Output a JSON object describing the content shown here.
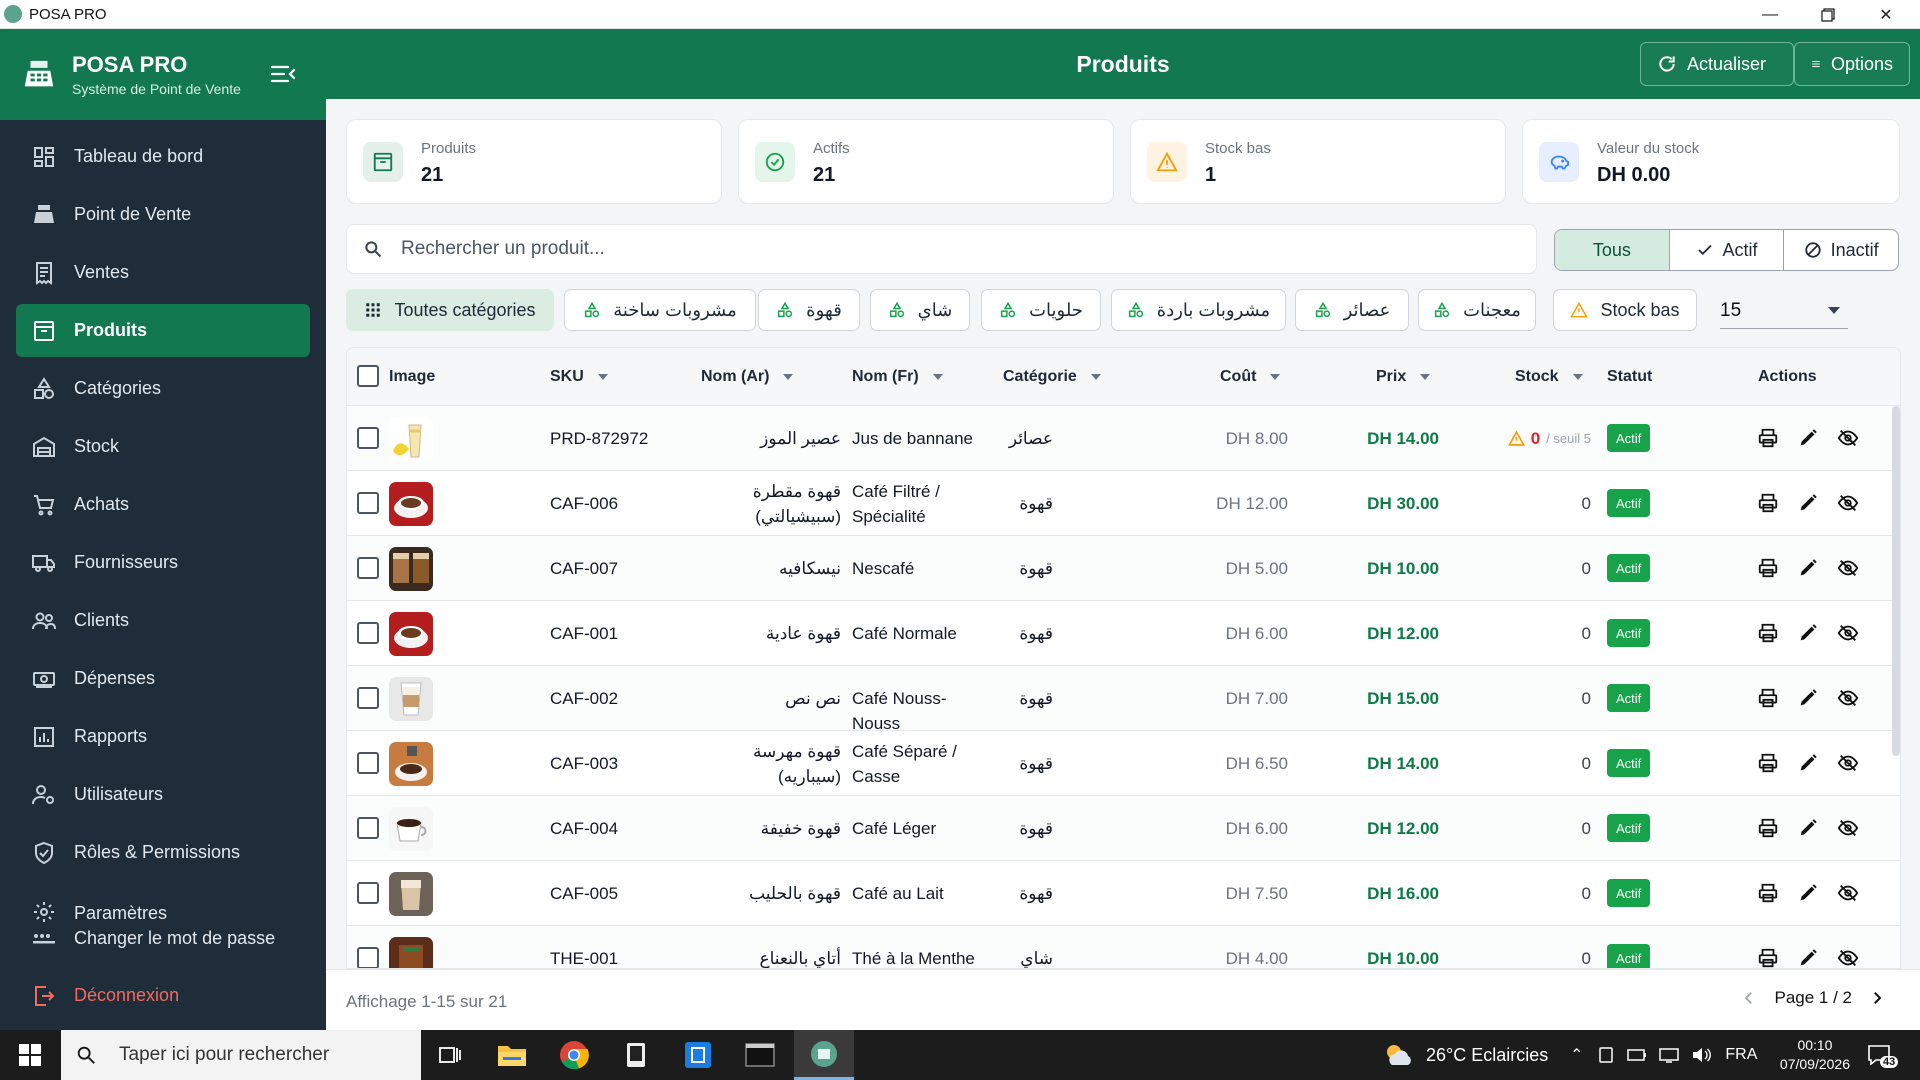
{
  "window": {
    "title": "POSA PRO"
  },
  "brand": {
    "name": "POSA PRO",
    "subtitle": "Système de Point de Vente"
  },
  "nav": [
    {
      "label": "Tableau de bord",
      "icon": "dashboard-icon"
    },
    {
      "label": "Point de Vente",
      "icon": "cash-register-icon"
    },
    {
      "label": "Ventes",
      "icon": "receipt-icon"
    },
    {
      "label": "Produits",
      "icon": "product-box-icon",
      "active": true
    },
    {
      "label": "Catégories",
      "icon": "categories-icon"
    },
    {
      "label": "Stock",
      "icon": "warehouse-icon"
    },
    {
      "label": "Achats",
      "icon": "cart-icon"
    },
    {
      "label": "Fournisseurs",
      "icon": "truck-icon"
    },
    {
      "label": "Clients",
      "icon": "users-icon"
    },
    {
      "label": "Dépenses",
      "icon": "money-icon"
    },
    {
      "label": "Rapports",
      "icon": "chart-icon"
    },
    {
      "label": "Utilisateurs",
      "icon": "user-cog-icon"
    },
    {
      "label": "Rôles & Permissions",
      "icon": "shield-icon"
    },
    {
      "label": "Paramètres",
      "icon": "gear-icon"
    }
  ],
  "nav_bottom": {
    "change_password": "Changer le mot de passe",
    "logout": "Déconnexion"
  },
  "header": {
    "title": "Produits",
    "refresh_label": "Actualiser",
    "options_label": "Options"
  },
  "stats": [
    {
      "label": "Produits",
      "value": "21",
      "icon": "box-icon",
      "color": "#11784f"
    },
    {
      "label": "Actifs",
      "value": "21",
      "icon": "check-circle-icon",
      "color": "#16a34a"
    },
    {
      "label": "Stock bas",
      "value": "1",
      "icon": "warning-icon",
      "color": "#f59e0b"
    },
    {
      "label": "Valeur du stock",
      "value": "DH 0.00",
      "icon": "piggy-bank-icon",
      "color": "#3b82f6"
    }
  ],
  "search": {
    "placeholder": "Rechercher un produit..."
  },
  "status_filter": {
    "all": "Tous",
    "active": "Actif",
    "inactive": "Inactif",
    "selected": "Tous"
  },
  "category_chips": [
    "Toutes catégories",
    "مشروبات ساخنة",
    "قهوة",
    "شاي",
    "حلويات",
    "مشروبات باردة",
    "عصائر",
    "معجنات"
  ],
  "low_stock_chip": "Stock bas",
  "per_page": "15",
  "table": {
    "columns": {
      "image": "Image",
      "sku": "SKU",
      "name_ar": "Nom (Ar)",
      "name_fr": "Nom (Fr)",
      "category": "Catégorie",
      "cost": "Coût",
      "price": "Prix",
      "stock": "Stock",
      "status": "Statut",
      "actions": "Actions"
    },
    "rows": [
      {
        "sku": "PRD-872972",
        "name_ar": "عصير الموز",
        "name_fr": "Jus de bannane",
        "category": "عصائر",
        "cost": "DH 8.00",
        "price": "DH 14.00",
        "stock": "0",
        "stock_low": true,
        "threshold": "/ seuil 5",
        "status": "Actif",
        "image": "banana-juice"
      },
      {
        "sku": "CAF-006",
        "name_ar": "قهوة مقطرة (سبيشيالتي)",
        "name_fr": "Café Filtré / Spécialité",
        "category": "قهوة",
        "cost": "DH 12.00",
        "price": "DH 30.00",
        "stock": "0",
        "status": "Actif",
        "image": "red-cup"
      },
      {
        "sku": "CAF-007",
        "name_ar": "نيسكافيه",
        "name_fr": "Nescafé",
        "category": "قهوة",
        "cost": "DH 5.00",
        "price": "DH 10.00",
        "stock": "0",
        "status": "Actif",
        "image": "glasses"
      },
      {
        "sku": "CAF-001",
        "name_ar": "قهوة عادية",
        "name_fr": "Café Normale",
        "category": "قهوة",
        "cost": "DH 6.00",
        "price": "DH 12.00",
        "stock": "0",
        "status": "Actif",
        "image": "red-cup"
      },
      {
        "sku": "CAF-002",
        "name_ar": "نص نص",
        "name_fr": "Café Nouss-Nouss",
        "category": "قهوة",
        "cost": "DH 7.00",
        "price": "DH 15.00",
        "stock": "0",
        "status": "Actif",
        "image": "latte-glass"
      },
      {
        "sku": "CAF-003",
        "name_ar": "قهوة مهرسة (سيباريه)",
        "name_fr": "Café Séparé / Casse",
        "category": "قهوة",
        "cost": "DH 6.50",
        "price": "DH 14.00",
        "stock": "0",
        "status": "Actif",
        "image": "espresso-pot"
      },
      {
        "sku": "CAF-004",
        "name_ar": "قهوة خفيفة",
        "name_fr": "Café Léger",
        "category": "قهوة",
        "cost": "DH 6.00",
        "price": "DH 12.00",
        "stock": "0",
        "status": "Actif",
        "image": "white-cup"
      },
      {
        "sku": "CAF-005",
        "name_ar": "قهوة بالحليب",
        "name_fr": "Café au Lait",
        "category": "قهوة",
        "cost": "DH 7.50",
        "price": "DH 16.00",
        "stock": "0",
        "status": "Actif",
        "image": "cafe-lait"
      },
      {
        "sku": "THE-001",
        "name_ar": "أتاي بالنعناع",
        "name_fr": "Thé à la Menthe",
        "category": "شاي",
        "cost": "DH 4.00",
        "price": "DH 10.00",
        "stock": "0",
        "status": "Actif",
        "image": "mint-tea"
      }
    ]
  },
  "footer": {
    "info": "Affichage 1-15 sur 21",
    "page": "Page 1 / 2"
  },
  "taskbar": {
    "search_placeholder": "Taper ici pour rechercher",
    "weather": "26°C  Eclaircies",
    "language": "FRA",
    "time": "00:10",
    "date": "07/09/2026",
    "notifications": "43"
  },
  "colors": {
    "primary": "#11784f",
    "sidebar": "#1f2d3a",
    "active_badge": "#16a34a",
    "price": "#0f7a48",
    "danger": "#dc2626"
  }
}
